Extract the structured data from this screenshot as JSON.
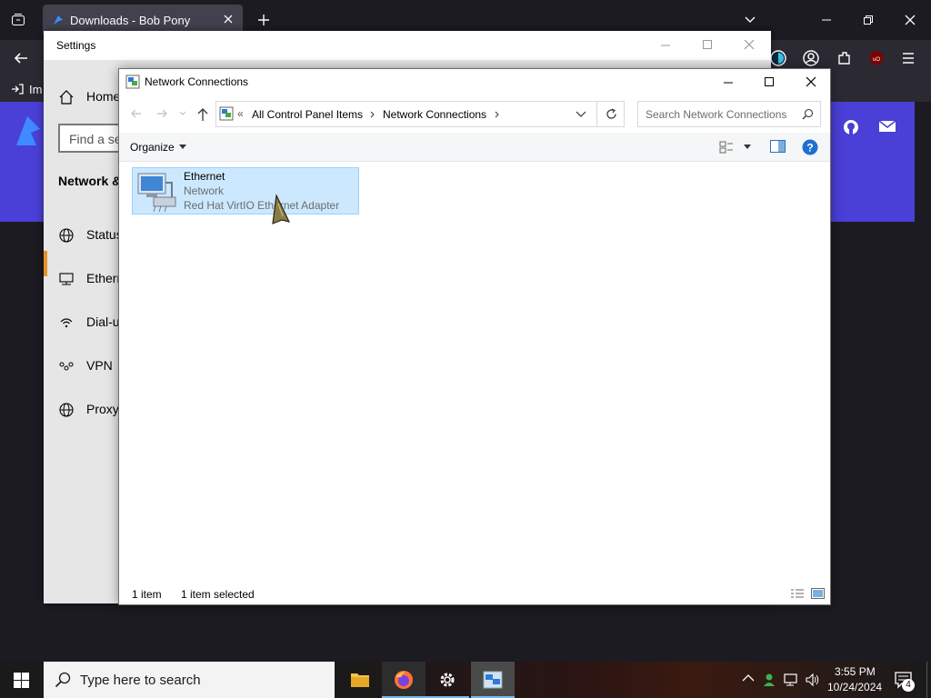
{
  "browser": {
    "tab_title": "Downloads - Bob Pony",
    "bookmark_label": "Im",
    "colors": {
      "hero": "#4a3fd6",
      "chrome": "#2b2a33"
    }
  },
  "settings": {
    "window_title": "Settings",
    "home_label": "Home",
    "search_placeholder": "Find a se",
    "section_title": "Network &",
    "nav": [
      {
        "label": "Status",
        "icon": "globe-status-icon"
      },
      {
        "label": "Ethern",
        "icon": "ethernet-icon"
      },
      {
        "label": "Dial-u",
        "icon": "dialup-icon"
      },
      {
        "label": "VPN",
        "icon": "vpn-icon"
      },
      {
        "label": "Proxy",
        "icon": "globe-icon"
      }
    ]
  },
  "explorer": {
    "window_title": "Network Connections",
    "breadcrumb": [
      "All Control Panel Items",
      "Network Connections"
    ],
    "search_placeholder": "Search Network Connections",
    "organize_label": "Organize",
    "item": {
      "name": "Ethernet",
      "status": "Network",
      "device": "Red Hat VirtIO Ethernet Adapter"
    },
    "status_count": "1 item",
    "status_selected": "1 item selected"
  },
  "taskbar": {
    "search_placeholder": "Type here to search",
    "time": "3:55 PM",
    "date": "10/24/2024",
    "notification_count": "4"
  }
}
